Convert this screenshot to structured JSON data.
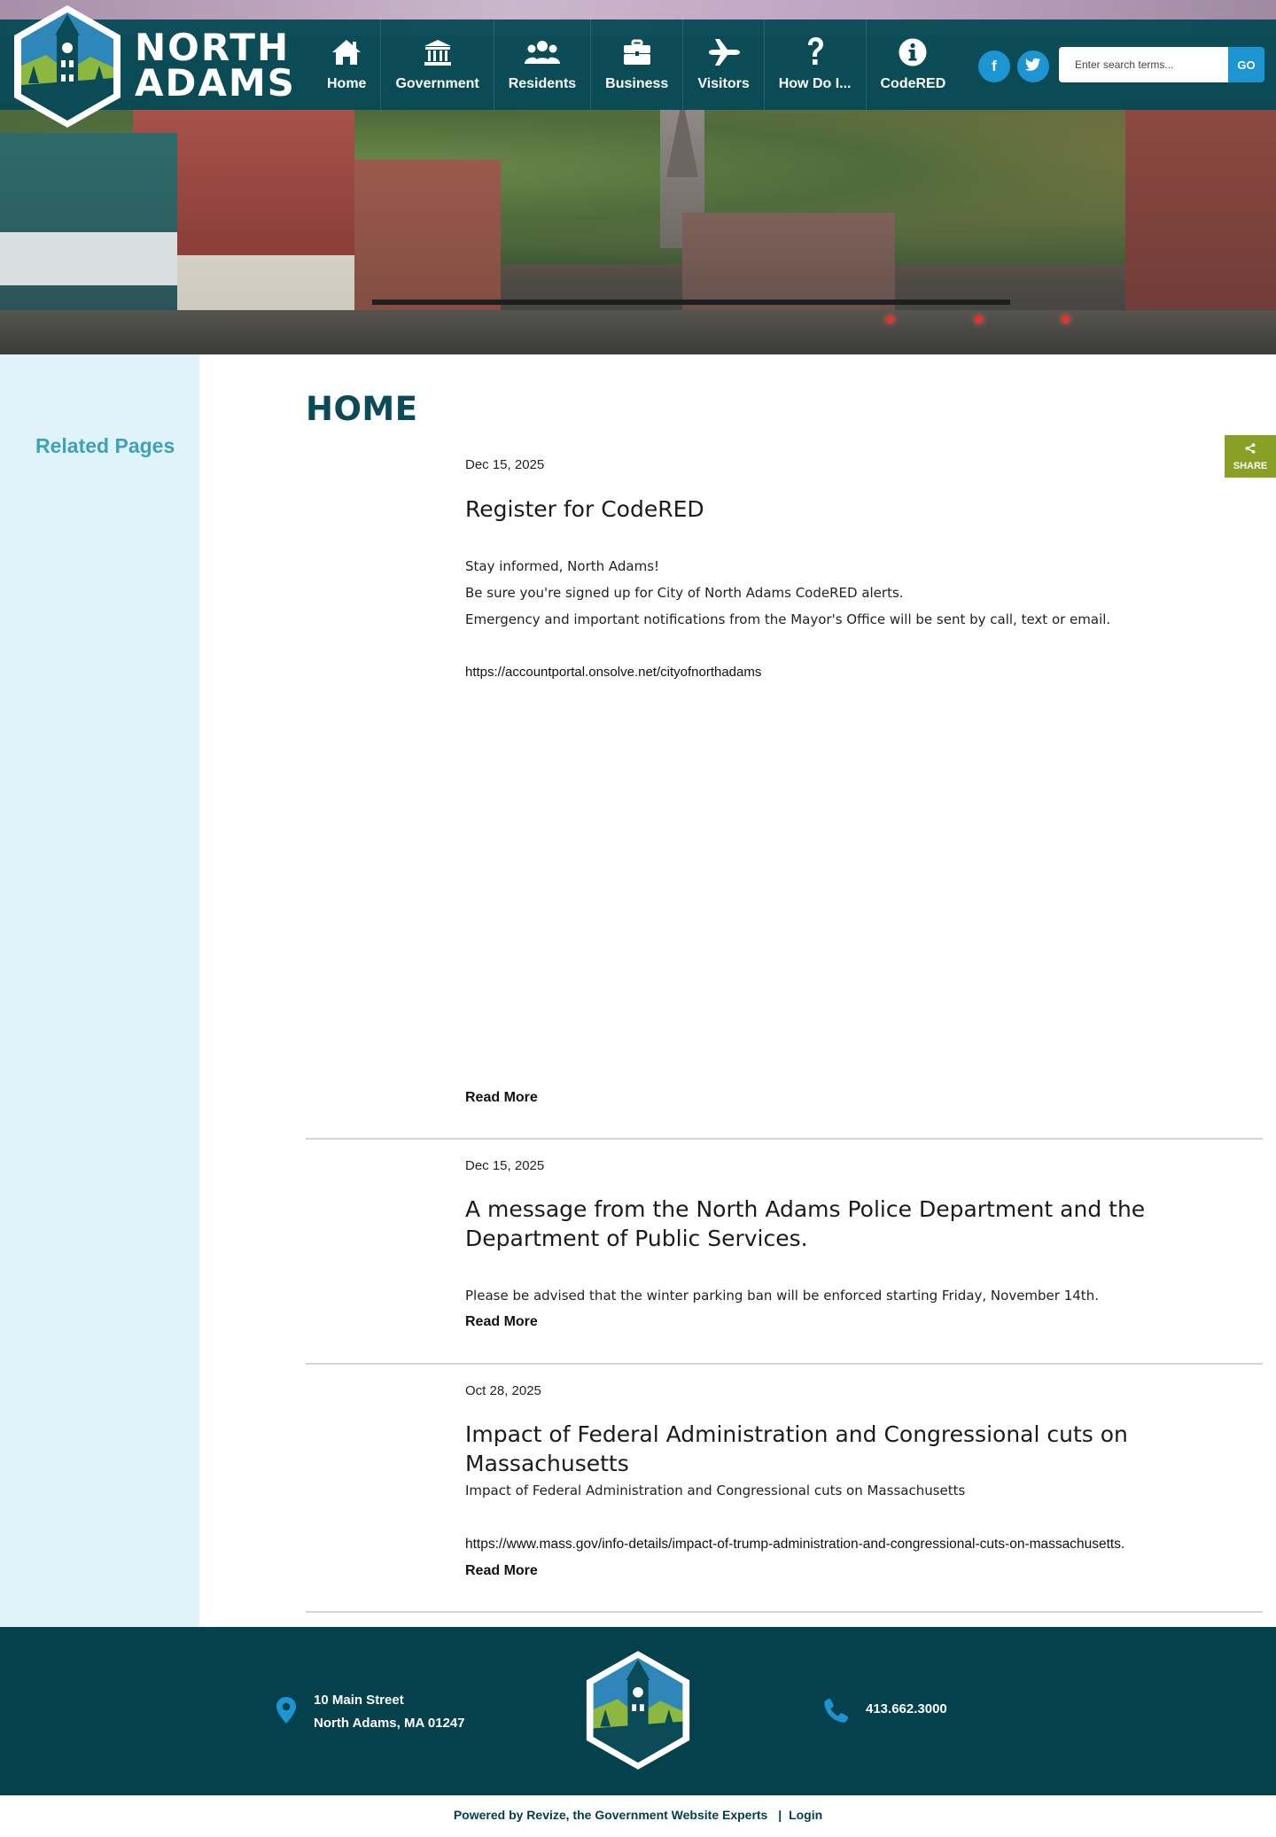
{
  "site": {
    "name_line1": "NORTH",
    "name_line2": "ADAMS"
  },
  "nav": [
    {
      "label": "Home",
      "icon": "home-icon"
    },
    {
      "label": "Government",
      "icon": "government-building-icon"
    },
    {
      "label": "Residents",
      "icon": "people-icon"
    },
    {
      "label": "Business",
      "icon": "briefcase-icon"
    },
    {
      "label": "Visitors",
      "icon": "airplane-icon"
    },
    {
      "label": "How Do I...",
      "icon": "question-mark-icon"
    },
    {
      "label": "CodeRED",
      "icon": "info-icon"
    }
  ],
  "social": [
    {
      "label": "f",
      "icon": "facebook-icon"
    },
    {
      "label": "",
      "icon": "twitter-icon"
    }
  ],
  "search": {
    "placeholder": "Enter search terms...",
    "value": "",
    "button_label": "GO"
  },
  "sidebar": {
    "heading": "Related Pages"
  },
  "page": {
    "title": "HOME"
  },
  "share": {
    "label": "SHARE"
  },
  "news": [
    {
      "date": "Dec 15, 2025",
      "title": "Register for CodeRED",
      "paragraphs": [
        "Stay informed, North Adams!",
        "Be sure you're signed up for City of North Adams CodeRED alerts.",
        "Emergency and important notifications from the Mayor's Office will be sent by call, text or email."
      ],
      "link": "https://accountportal.onsolve.net/cityofnorthadams",
      "read_more": "Read More"
    },
    {
      "date": "Dec 15, 2025",
      "title": "A message from the North Adams Police Department and the Department of Public Services.",
      "paragraphs": [
        "Please be advised that the winter parking ban will be enforced starting Friday, November 14th."
      ],
      "link": "",
      "read_more": "Read More"
    },
    {
      "date": "Oct 28, 2025",
      "title": "Impact of Federal Administration and Congressional cuts on Massachusetts",
      "paragraphs": [
        "Impact of Federal Administration and Congressional cuts on Massachusetts"
      ],
      "link": "https://www.mass.gov/info-details/impact-of-trump-administration-and-congressional-cuts-on-massachusetts.",
      "read_more": "Read More"
    }
  ],
  "footer": {
    "address_line1": "10 Main Street",
    "address_line2": "North Adams, MA 01247",
    "phone": "413.662.3000",
    "powered_by": "Powered by Revize, the Government Website Experts",
    "separator": "|",
    "login": "Login"
  },
  "colors": {
    "header_teal": "#054854",
    "footer_teal": "#05404d",
    "accent_blue": "#1e95d3",
    "sidebar_bg": "#dff3f8",
    "sidebar_heading": "#3ea2bb",
    "share_green": "#8aa024"
  }
}
